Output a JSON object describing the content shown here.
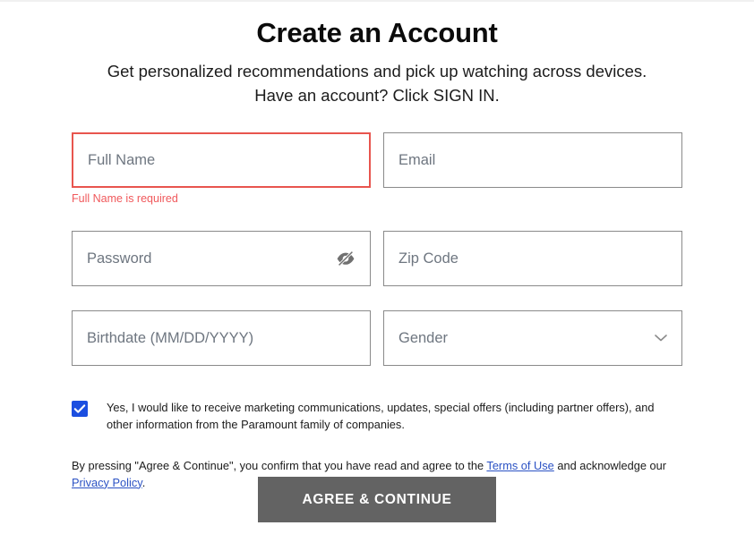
{
  "header": {
    "title": "Create an Account",
    "subtitle": "Get personalized recommendations and pick up watching across devices. Have an account? Click SIGN IN."
  },
  "form": {
    "fields": {
      "full_name": {
        "placeholder": "Full Name",
        "value": "",
        "error": "Full Name is required",
        "has_error": true
      },
      "email": {
        "placeholder": "Email",
        "value": ""
      },
      "password": {
        "placeholder": "Password",
        "value": "",
        "toggle_icon": "eye-off-icon"
      },
      "zip_code": {
        "placeholder": "Zip Code",
        "value": ""
      },
      "birthdate": {
        "placeholder": "Birthdate (MM/DD/YYYY)",
        "value": ""
      },
      "gender": {
        "placeholder": "Gender",
        "value": "",
        "icon": "chevron-down-icon"
      }
    },
    "marketing_consent": {
      "checked": true,
      "label": "Yes, I would like to receive marketing communications, updates, special offers (including partner offers), and other information from the Paramount family of companies."
    },
    "legal": {
      "text_before_terms": "By pressing \"Agree & Continue\", you confirm that you have read and agree to the ",
      "terms_link": "Terms of Use",
      "text_between": " and acknowledge our ",
      "privacy_link": "Privacy Policy",
      "text_after": "."
    },
    "submit_label": "AGREE & CONTINUE"
  },
  "colors": {
    "error_border": "#e8554e",
    "error_text": "#f0595c",
    "checkbox_blue": "#1b4ee0",
    "link_blue": "#2b52c4",
    "button_gray": "#636363",
    "field_border": "#8a8a8a",
    "placeholder_text": "#6e7680"
  }
}
